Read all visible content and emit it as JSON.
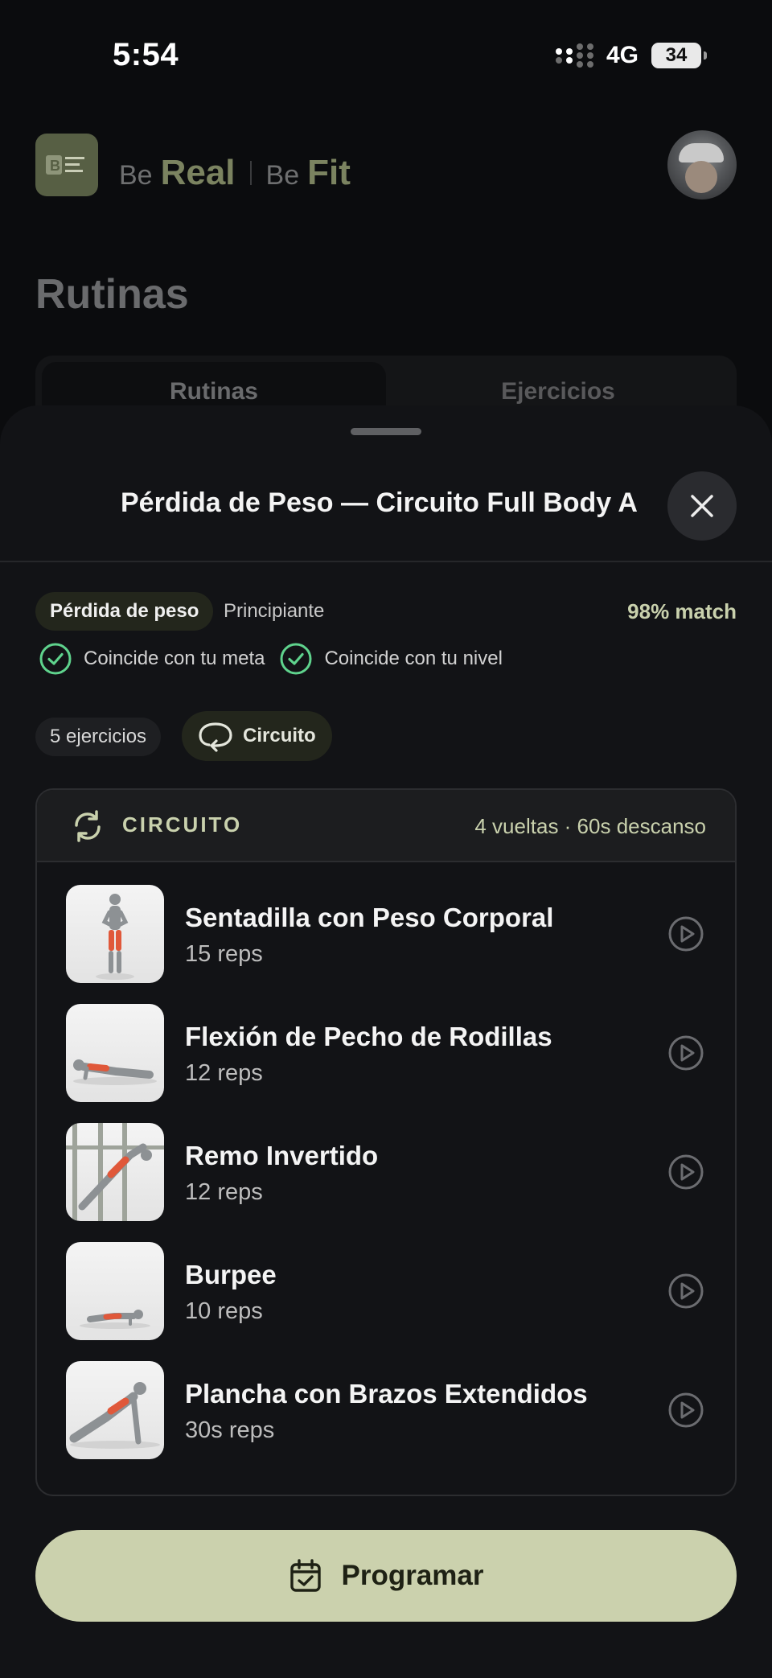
{
  "status_bar": {
    "time": "5:54",
    "network": "4G",
    "battery": "34"
  },
  "header": {
    "logo_text": "B real fit",
    "brand": {
      "be1": "Be",
      "real": "Real",
      "be2": "Be",
      "fit": "Fit"
    },
    "page_title": "Rutinas",
    "tabs": [
      {
        "label": "Rutinas",
        "active": true
      },
      {
        "label": "Ejercicios",
        "active": false
      }
    ]
  },
  "sheet": {
    "title": "Pérdida de Peso — Circuito Full Body A",
    "goal_tag": "Pérdida de peso",
    "level_tag": "Principiante",
    "match": "98% match",
    "checks": [
      "Coincide con tu meta",
      "Coincide con tu nivel"
    ],
    "exercise_count": "5 ejercicios",
    "format_pill": "Circuito",
    "circuit": {
      "label": "CIRCUITO",
      "meta": "4 vueltas · 60s descanso",
      "exercises": [
        {
          "name": "Sentadilla con Peso Corporal",
          "reps": "15 reps",
          "icon": "squat-figure"
        },
        {
          "name": "Flexión de Pecho de Rodillas",
          "reps": "12 reps",
          "icon": "pushup-figure"
        },
        {
          "name": "Remo Invertido",
          "reps": "12 reps",
          "icon": "row-figure"
        },
        {
          "name": "Burpee",
          "reps": "10 reps",
          "icon": "burpee-figure"
        },
        {
          "name": "Plancha con Brazos Extendidos",
          "reps": "30s reps",
          "icon": "plank-figure"
        }
      ]
    },
    "cta_label": "Programar"
  },
  "colors": {
    "accent": "#cbd1ad",
    "accent_text": "#c9d1ad",
    "check_green": "#5fd38d",
    "sheet_bg": "#121316",
    "muscle_highlight": "#e0583a"
  }
}
